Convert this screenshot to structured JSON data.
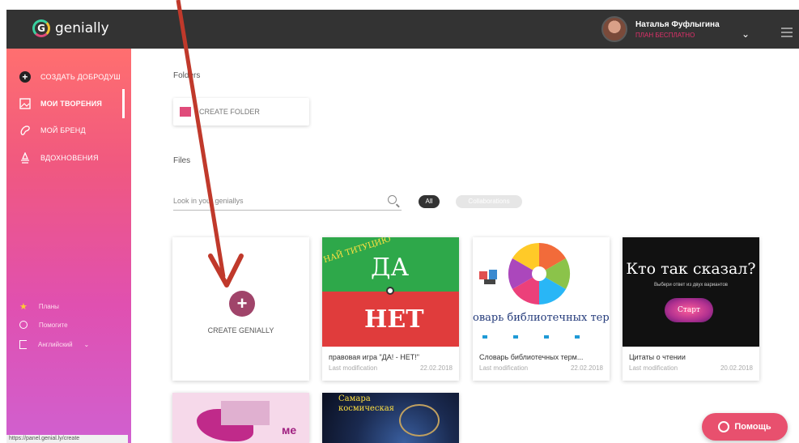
{
  "header": {
    "logo_text": "genially",
    "user_name": "Наталья Фуфлыгина",
    "user_plan": "ПЛАН БЕСПЛАТНО"
  },
  "sidebar": {
    "items": [
      {
        "label": "СОЗДАТЬ ДОБРОДУШ",
        "icon": "plus-circle-icon"
      },
      {
        "label": "МОИ ТВОРЕНИЯ",
        "icon": "gallery-icon"
      },
      {
        "label": "МОЙ БРЕНД",
        "icon": "brand-icon"
      },
      {
        "label": "ВДОХНОВЕНИЯ",
        "icon": "inspiration-icon"
      }
    ],
    "bottom": [
      {
        "label": "Планы",
        "icon": "star-icon"
      },
      {
        "label": "Помогите",
        "icon": "help-icon"
      },
      {
        "label": "Английский",
        "icon": "flag-icon"
      }
    ]
  },
  "status_url": "https://panel.genial.ly/create",
  "main": {
    "folders_label": "Folders",
    "create_folder": "CREATE FOLDER",
    "files_label": "Files",
    "search_placeholder": "Look in your geniallys",
    "filter_all": "All",
    "filter_collab": "Collaborations",
    "create_genially": "CREATE GENIALLY",
    "projects": [
      {
        "title": "правовая игра \"ДА! - НЕТ!\"",
        "meta": "Last modification",
        "date": "22.02.2018",
        "thumb_top": "ДА",
        "thumb_bottom": "НЕТ",
        "thumb_tag": "НАЙ ТИТУЦИЮ"
      },
      {
        "title": "Словарь библиотечных терм...",
        "meta": "Last modification",
        "date": "22.02.2018",
        "thumb_text": "оварь библиотечных терми"
      },
      {
        "title": "Цитаты о чтении",
        "meta": "Last modification",
        "date": "20.02.2018",
        "thumb_title": "Кто так сказал?",
        "thumb_sub": "Выбери ответ из двух вариантов",
        "thumb_btn": "Старт"
      }
    ],
    "partial_thumbs": [
      {
        "text": "ме"
      },
      {
        "text": "Самара космическая"
      }
    ]
  },
  "help_button": "Помощь",
  "colors": {
    "accent": "#e8506e",
    "topbar": "#333333"
  }
}
